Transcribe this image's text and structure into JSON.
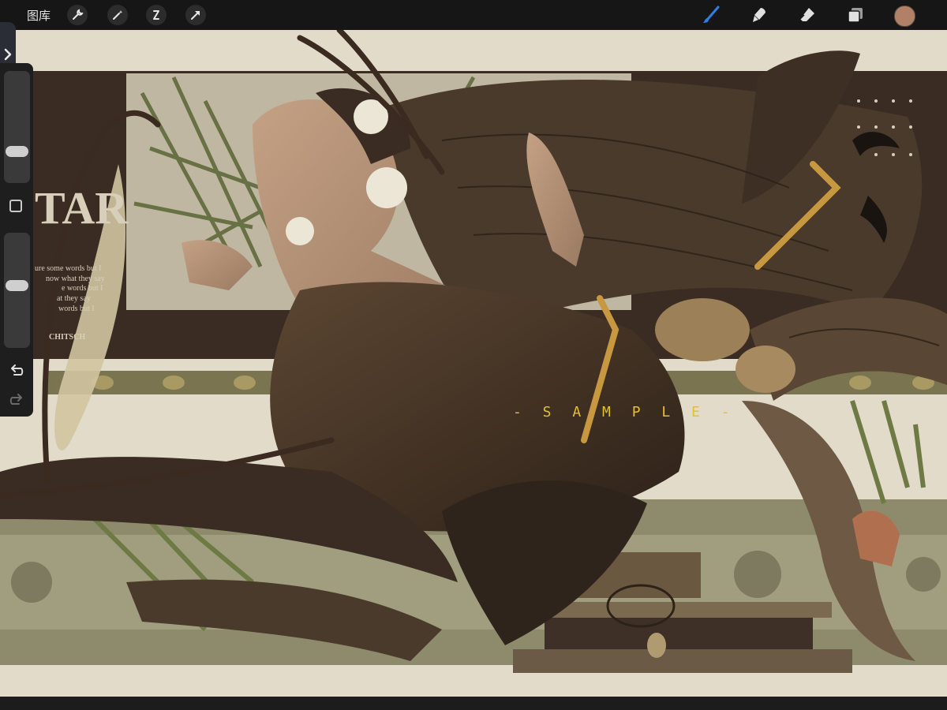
{
  "topbar": {
    "gallery_label": "图库",
    "left_tools": [
      "wrench-icon",
      "magic-wand-icon",
      "selection-icon",
      "transform-arrow-icon"
    ],
    "right_tools": [
      "brush-icon",
      "smudge-icon",
      "eraser-icon",
      "layers-icon"
    ],
    "current_color": "#b08166",
    "active_tool_color": "#2f7fe0"
  },
  "canvas": {
    "watermark": "- S A M P L E -",
    "title_partial": "TAR",
    "body_lines": [
      "ure some words but I",
      "now what they say",
      "e words but I",
      "at they say",
      "words but I"
    ],
    "author_partial": "CHITSCH"
  },
  "sidebar": {
    "expand_icon": "chevron-right-icon",
    "brush_size_value": 0.25,
    "opacity_value": 0.55,
    "modify_icon": "square-icon",
    "undo_icon": "undo-arrow-icon",
    "redo_icon": "redo-arrow-icon"
  }
}
